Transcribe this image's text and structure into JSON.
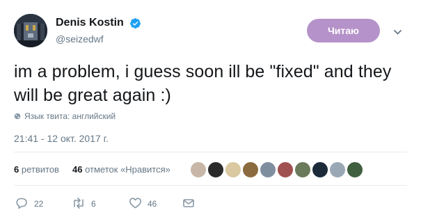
{
  "user": {
    "name": "Denis Kostin",
    "handle": "@seizedwf",
    "follow_label": "Читаю"
  },
  "tweet": {
    "text": "im a problem, i guess soon ill be \"fixed\" and they will be great again :)",
    "language_label": "Язык твита: английский",
    "timestamp": "21:41 - 12 окт. 2017 г."
  },
  "stats": {
    "retweets_count": "6",
    "retweets_label": "ретвитов",
    "likes_count": "46",
    "likes_label": "отметок «Нравится»"
  },
  "actions": {
    "replies": "22",
    "retweets": "6",
    "likes": "46"
  },
  "colors": {
    "follow_button": "#b592c9",
    "verified": "#1da1f2",
    "muted_text": "#657786"
  }
}
